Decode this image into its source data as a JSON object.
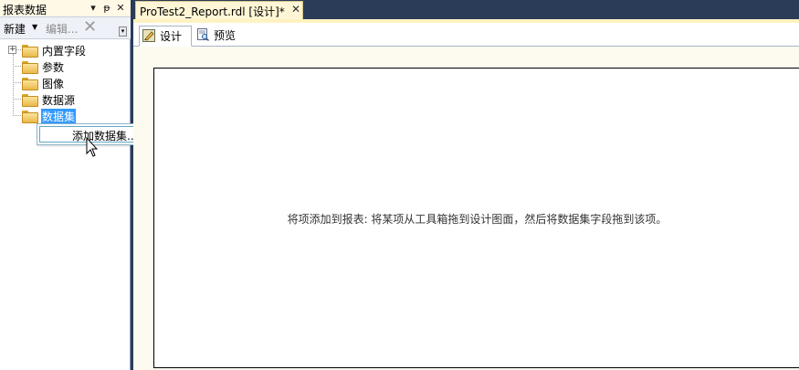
{
  "report_data_panel": {
    "title": "报表数据",
    "title_buttons": [
      "▾",
      "ᵽ",
      "✕"
    ],
    "toolbar": {
      "new_label": "新建",
      "new_dropdown": "▼",
      "edit_label": "编辑...",
      "delete_glyph": "✕",
      "overflow_glyph": "▾"
    },
    "tree": {
      "expander_glyph": "+",
      "items": [
        {
          "label": "内置字段",
          "icon": "folder-icon"
        },
        {
          "label": "参数",
          "icon": "folder-icon"
        },
        {
          "label": "图像",
          "icon": "folder-icon"
        },
        {
          "label": "数据源",
          "icon": "folder-icon"
        },
        {
          "label": "数据集",
          "icon": "folder-icon",
          "selected": true
        }
      ]
    }
  },
  "context_menu": {
    "items": [
      {
        "label": "添加数据集..."
      }
    ]
  },
  "document": {
    "tab_label": "ProTest2_Report.rdl [设计]*",
    "tab_close_glyph": "✕",
    "view_tabs": [
      {
        "label": "设计",
        "icon": "design-icon",
        "active": true
      },
      {
        "label": "预览",
        "icon": "preview-icon",
        "active": false
      }
    ],
    "canvas_hint": "将项添加到报表: 将某项从工具箱拖到设计图面，然后将数据集字段拖到该项。"
  },
  "colors": {
    "ide_background": "#2b3c59",
    "selection": "#3399ff",
    "doc_tab": "#fff6d6",
    "design_surface": "#fdfaf0"
  }
}
